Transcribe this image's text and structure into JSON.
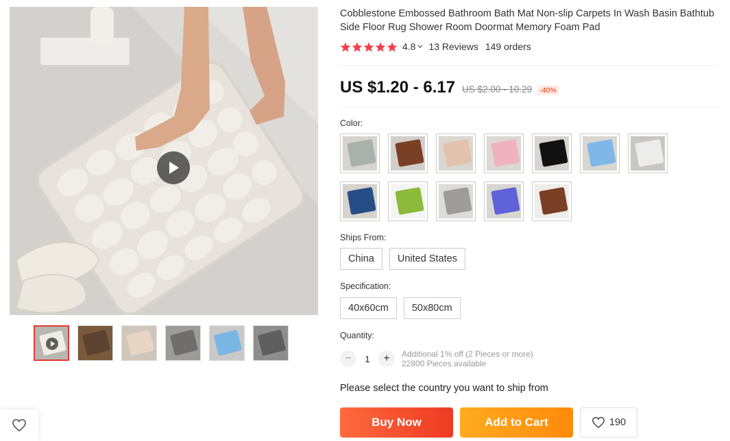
{
  "gallery": {
    "thumbnails": [
      {
        "name": "thumb-1",
        "bg": "#b8b6b1",
        "mat": "#efece6",
        "active": true,
        "video": true
      },
      {
        "name": "thumb-2",
        "bg": "#7a5a3c",
        "mat": "#5c4330",
        "active": false,
        "video": false
      },
      {
        "name": "thumb-3",
        "bg": "#cfc7bc",
        "mat": "#e8d6c4",
        "active": false,
        "video": false
      },
      {
        "name": "thumb-4",
        "bg": "#9d9c98",
        "mat": "#6f6e6b",
        "active": false,
        "video": false
      },
      {
        "name": "thumb-5",
        "bg": "#c9c9c9",
        "mat": "#79b6e3",
        "active": false,
        "video": false
      },
      {
        "name": "thumb-6",
        "bg": "#8d8d8d",
        "mat": "#5e5e5e",
        "active": false,
        "video": false
      }
    ]
  },
  "product": {
    "title": "Cobblestone Embossed Bathroom Bath Mat Non-slip Carpets In Wash Basin Bathtub Side Floor Rug Shower Room Doormat Memory Foam Pad",
    "rating": "4.8",
    "reviews": "13 Reviews",
    "orders": "149 orders",
    "price": "US $1.20 - 6.17",
    "original_price": "US $2.00 - 10.29",
    "discount": "-40%"
  },
  "colors": {
    "label": "Color:",
    "swatches": [
      {
        "mat": "#a9b1ab",
        "bg": "#d7d4cf"
      },
      {
        "mat": "#7a4025",
        "bg": "#d2cfca"
      },
      {
        "mat": "#e3c2ae",
        "bg": "#dad6d1"
      },
      {
        "mat": "#efb3bf",
        "bg": "#dcd8d3"
      },
      {
        "mat": "#111111",
        "bg": "#d8d4cf"
      },
      {
        "mat": "#7fb8e8",
        "bg": "#d9d6d0"
      },
      {
        "mat": "#ececea",
        "bg": "#c9c6c1"
      },
      {
        "mat": "#254d86",
        "bg": "#d6d2cc"
      },
      {
        "mat": "#8cbb3c",
        "bg": "#f4f4f2"
      },
      {
        "mat": "#9e9c99",
        "bg": "#dedcd8"
      },
      {
        "mat": "#5f62d8",
        "bg": "#d9d6d1"
      },
      {
        "mat": "#7a3f24",
        "bg": "#efede9"
      }
    ]
  },
  "ships_from": {
    "label": "Ships From:",
    "options": [
      "China",
      "United States"
    ]
  },
  "specification": {
    "label": "Specification:",
    "options": [
      "40x60cm",
      "50x80cm"
    ]
  },
  "quantity": {
    "label": "Quantity:",
    "value": "1",
    "minus": "−",
    "plus": "+",
    "note_1": "Additional 1% off (2 Pieces or more)",
    "note_2": "22800 Pieces available"
  },
  "ship_note": "Please select the country you want to ship from",
  "actions": {
    "buy_now": "Buy Now",
    "add_to_cart": "Add to Cart",
    "wishlist_count": "190"
  },
  "colors_theme": {
    "star": "#f53d4a",
    "buy_now": "#ee3a23",
    "add_to_cart": "#ff8a0a",
    "discount": "#e62e04"
  }
}
